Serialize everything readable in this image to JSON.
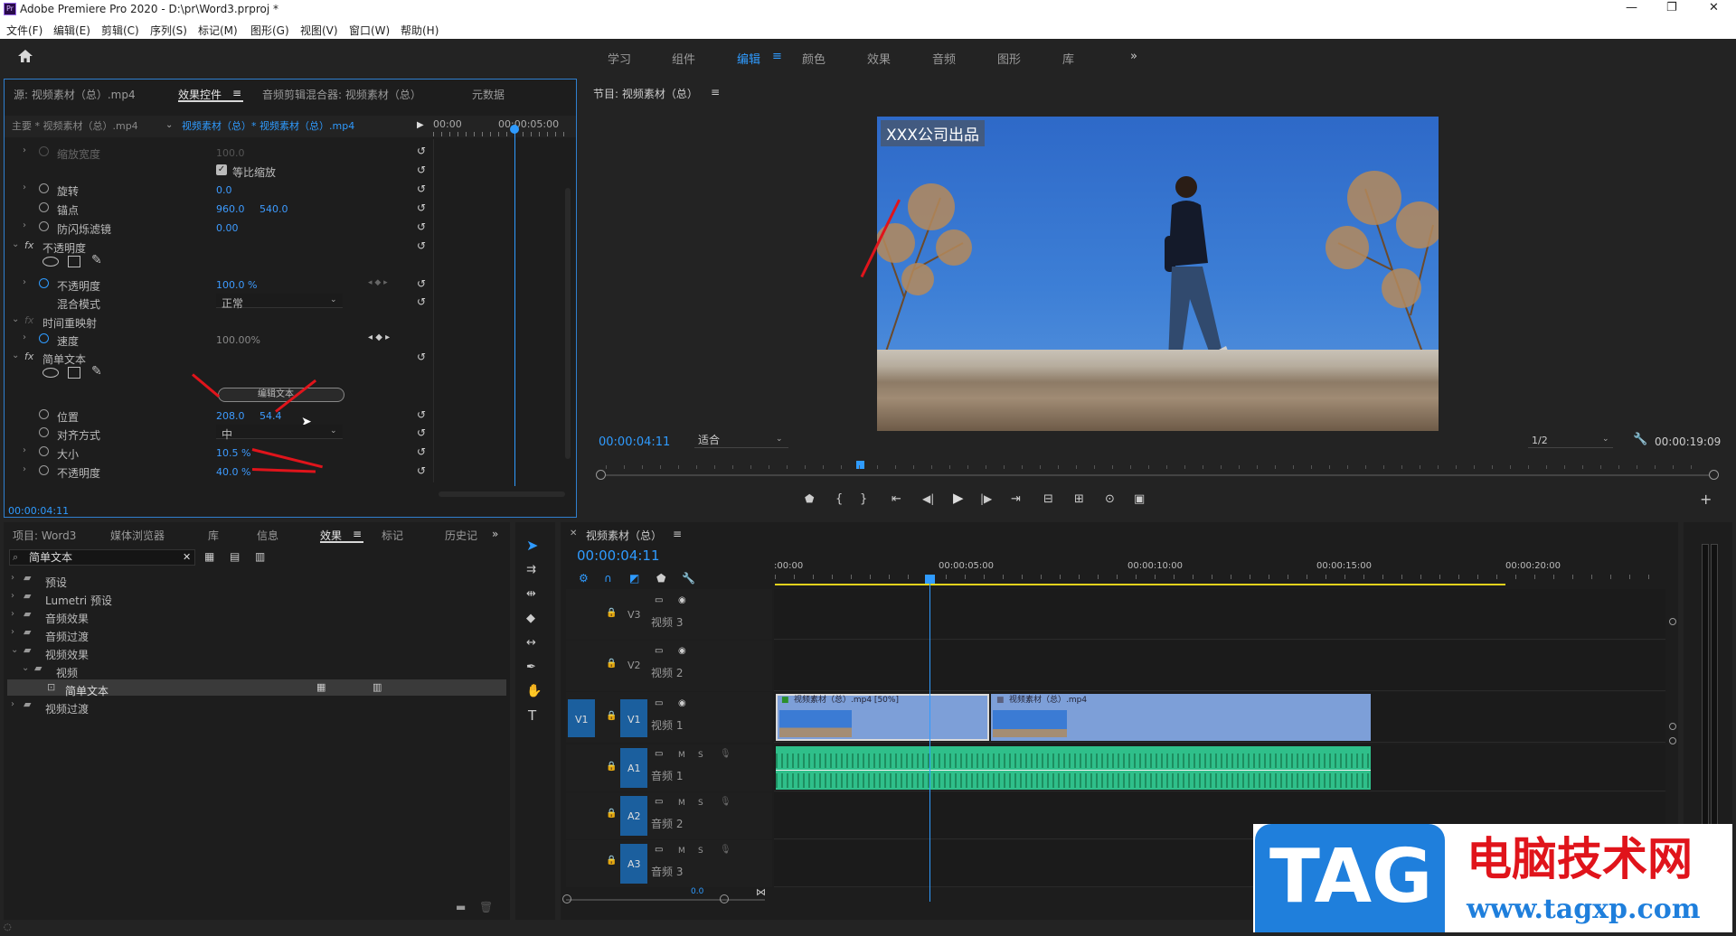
{
  "app": {
    "title": "Adobe Premiere Pro 2020 - D:\\pr\\Word3.prproj *",
    "icon_label": "Pr"
  },
  "window_controls": {
    "minimize": "—",
    "restore": "❐",
    "close": "✕"
  },
  "menu": [
    "文件(F)",
    "编辑(E)",
    "剪辑(C)",
    "序列(S)",
    "标记(M)",
    "图形(G)",
    "视图(V)",
    "窗口(W)",
    "帮助(H)"
  ],
  "workspaces": {
    "items": [
      "学习",
      "组件",
      "编辑",
      "颜色",
      "效果",
      "音频",
      "图形",
      "库"
    ],
    "active": "编辑",
    "more": "»"
  },
  "effect_controls": {
    "tabs": [
      "源: 视频素材（总）.mp4",
      "效果控件",
      "音频剪辑混合器: 视频素材（总）",
      "元数据"
    ],
    "active_tab": "效果控件",
    "master_label": "主要 * 视频素材（总）.mp4",
    "clip_label": "视频素材（总）* 视频素材（总）.mp4",
    "ruler": [
      "00:00",
      "00:00:05:00"
    ],
    "properties": {
      "scale_width": {
        "label": "缩放宽度",
        "value": "100.0"
      },
      "uniform_scale": {
        "label": "等比缩放",
        "checked": true
      },
      "rotation": {
        "label": "旋转",
        "value": "0.0"
      },
      "anchor": {
        "label": "锚点",
        "x": "960.0",
        "y": "540.0"
      },
      "anti_flicker": {
        "label": "防闪烁滤镜",
        "value": "0.00"
      },
      "opacity_section": {
        "label": "不透明度"
      },
      "opacity": {
        "label": "不透明度",
        "value": "100.0 %"
      },
      "blend_mode": {
        "label": "混合模式",
        "value": "正常"
      },
      "time_remap": {
        "label": "时间重映射"
      },
      "speed": {
        "label": "速度",
        "value": "100.00%"
      },
      "simple_text": {
        "label": "简单文本"
      },
      "edit_text_button": "编辑文本",
      "position": {
        "label": "位置",
        "x": "208.0",
        "y": "54.4"
      },
      "alignment": {
        "label": "对齐方式",
        "value": "中"
      },
      "size": {
        "label": "大小",
        "value": "10.5 %"
      },
      "text_opacity": {
        "label": "不透明度",
        "value": "40.0 %"
      }
    },
    "fx_glyph": "fx",
    "timecode": "00:00:04:11"
  },
  "program_monitor": {
    "title": "节目: 视频素材（总）",
    "overlay_text": "XXX公司出品",
    "timecode": "00:00:04:11",
    "fit": "适合",
    "resolution": "1/2",
    "duration": "00:00:19:09",
    "playhead_fraction": 0.23
  },
  "project_panel": {
    "tabs": [
      "项目: Word3",
      "媒体浏览器",
      "库",
      "信息",
      "效果",
      "标记",
      "历史记"
    ],
    "active_tab": "效果",
    "search_value": "简单文本",
    "tree": [
      {
        "label": "预设",
        "level": 0,
        "open": false
      },
      {
        "label": "Lumetri 预设",
        "level": 0,
        "open": false
      },
      {
        "label": "音频效果",
        "level": 0,
        "open": false
      },
      {
        "label": "音频过渡",
        "level": 0,
        "open": false
      },
      {
        "label": "视频效果",
        "level": 0,
        "open": true
      },
      {
        "label": "视频",
        "level": 1,
        "open": true
      },
      {
        "label": "简单文本",
        "level": 2,
        "selected": true
      },
      {
        "label": "视频过渡",
        "level": 0,
        "open": false
      }
    ]
  },
  "timeline": {
    "title": "视频素材（总）",
    "timecode": "00:00:04:11",
    "ruler": [
      ":00:00",
      "00:00:05:00",
      "00:00:10:00",
      "00:00:15:00",
      "00:00:20:00"
    ],
    "tracks": [
      {
        "id": "V3",
        "name": "视频 3"
      },
      {
        "id": "V2",
        "name": "视频 2"
      },
      {
        "id": "V1",
        "name": "视频 1",
        "source": "V1"
      },
      {
        "id": "A1",
        "name": "音频 1"
      },
      {
        "id": "A2",
        "name": "音频 2"
      },
      {
        "id": "A3",
        "name": "音频 3"
      }
    ],
    "clips": [
      {
        "label": "视频素材（总）.mp4 [50%]"
      },
      {
        "label": "视频素材（总）.mp4"
      }
    ],
    "mute_label": "M",
    "solo_label": "S",
    "bottom_value": "0.0"
  },
  "watermark": {
    "logo_text": "TAG",
    "site_name": "电脑技术网",
    "url": "www.tagxp.com"
  },
  "colors": {
    "accent": "#2f9bff",
    "audio_clip": "#2fbf8a",
    "video_clip": "#7d9fd8",
    "track_highlight": "#1b5f9e",
    "arrow_red": "#e0141b"
  }
}
